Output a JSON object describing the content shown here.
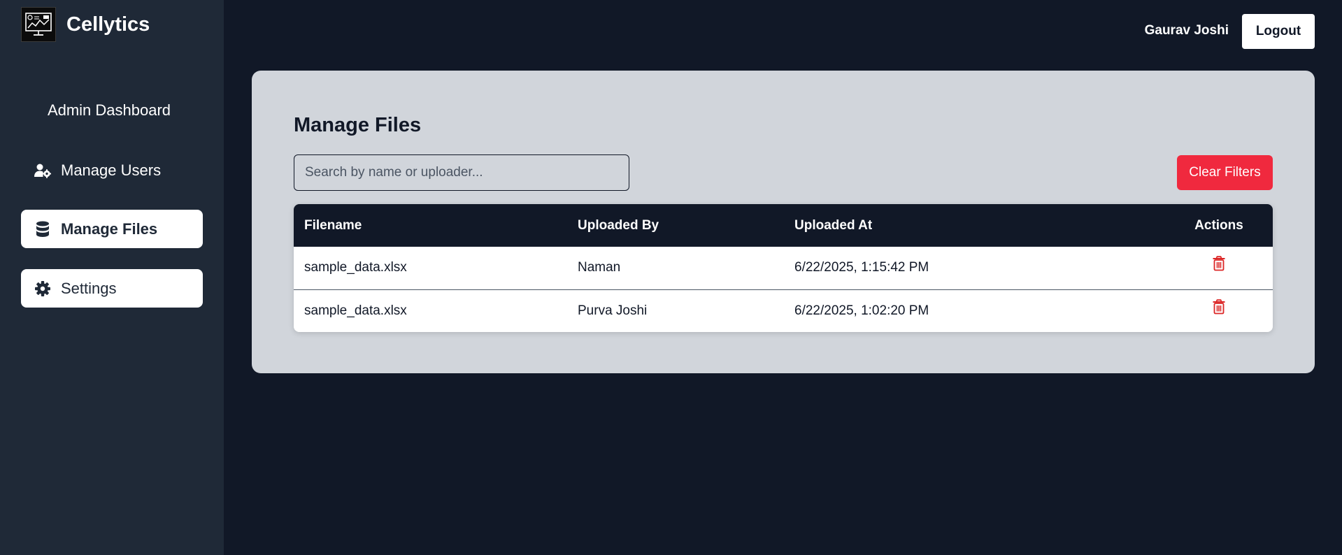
{
  "brand": {
    "name": "Cellytics",
    "logo_icon": "dashboard-monitor-icon"
  },
  "sidebar": {
    "heading": "Admin Dashboard",
    "items": [
      {
        "label": "Manage Users",
        "icon": "user-gear-icon",
        "active": false
      },
      {
        "label": "Manage Files",
        "icon": "database-icon",
        "active": true
      },
      {
        "label": "Settings",
        "icon": "gear-icon",
        "active": false
      }
    ]
  },
  "header": {
    "user_name": "Gaurav Joshi",
    "logout_label": "Logout"
  },
  "main": {
    "title": "Manage Files",
    "search": {
      "placeholder": "Search by name or uploader...",
      "value": ""
    },
    "clear_filters_label": "Clear Filters",
    "table": {
      "columns": [
        "Filename",
        "Uploaded By",
        "Uploaded At",
        "Actions"
      ],
      "rows": [
        {
          "filename": "sample_data.xlsx",
          "uploaded_by": "Naman",
          "uploaded_at": "6/22/2025, 1:15:42 PM",
          "action_icon": "trash-icon"
        },
        {
          "filename": "sample_data.xlsx",
          "uploaded_by": "Purva Joshi",
          "uploaded_at": "6/22/2025, 1:02:20 PM",
          "action_icon": "trash-icon"
        }
      ]
    }
  },
  "colors": {
    "page_bg": "#111827",
    "sidebar_bg": "#1f2937",
    "panel_bg": "#d1d5db",
    "danger": "#f0293e",
    "trash": "#dc2626"
  }
}
